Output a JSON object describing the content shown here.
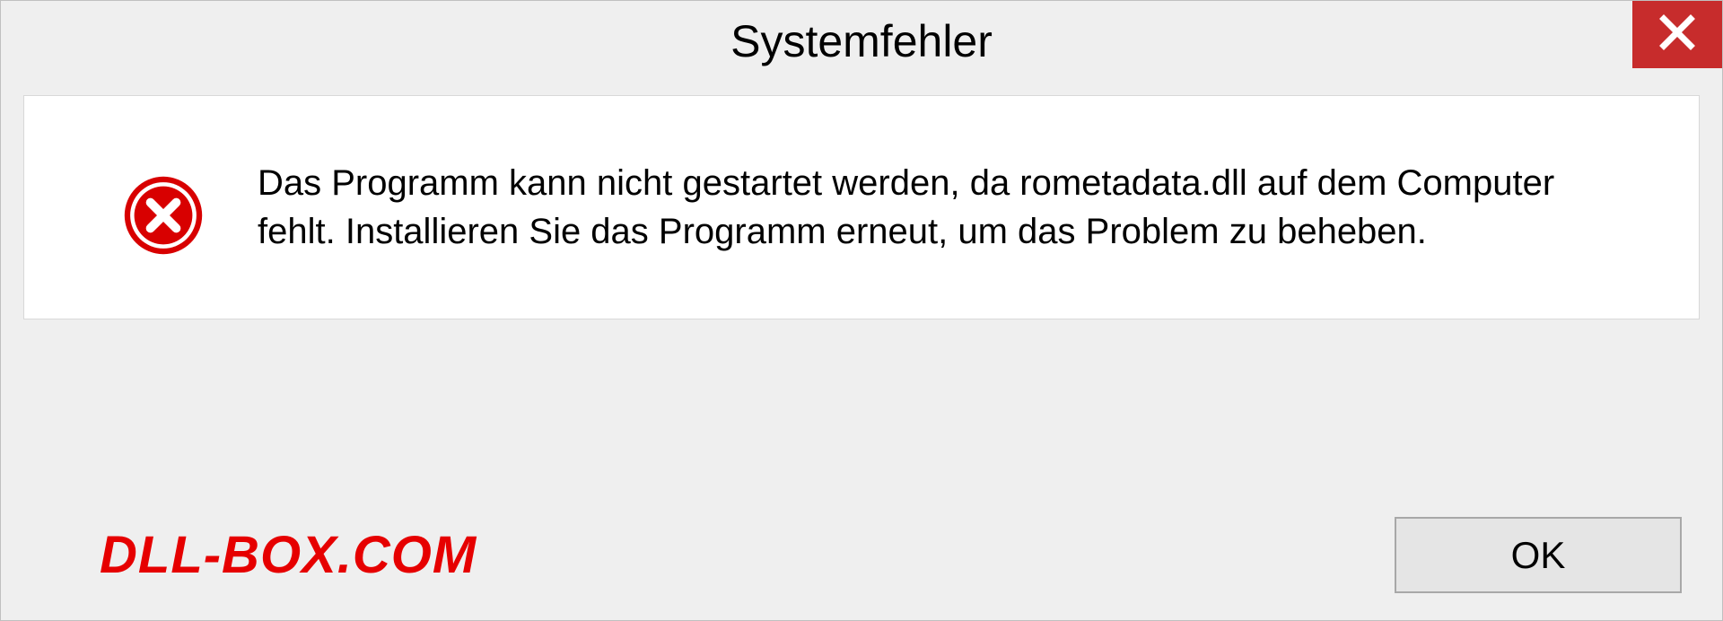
{
  "titlebar": {
    "title": "Systemfehler"
  },
  "body": {
    "message": "Das Programm kann nicht gestartet werden, da rometadata.dll auf dem Computer fehlt. Installieren Sie das Programm erneut, um das Problem zu beheben."
  },
  "footer": {
    "watermark": "DLL-BOX.COM",
    "ok_label": "OK"
  }
}
